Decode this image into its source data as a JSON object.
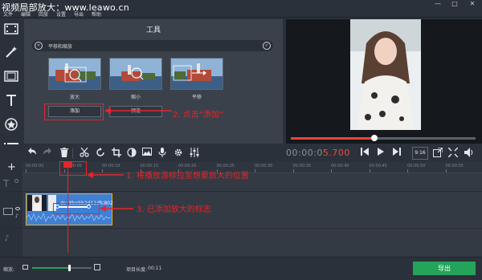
{
  "watermark": "视频局部放大：www.leawo.cn",
  "menu": [
    {
      "label": "文件"
    },
    {
      "label": "编辑"
    },
    {
      "label": "回放"
    },
    {
      "label": "设置"
    },
    {
      "label": "导出"
    },
    {
      "label": "帮助"
    }
  ],
  "window_controls": [
    "—",
    "□",
    "✕"
  ],
  "tools_panel": {
    "title": "工具",
    "section_label": "平移和缩放",
    "back_symbol": "«",
    "check_symbol": "✓",
    "options": [
      {
        "label": "放大"
      },
      {
        "label": "缩小"
      },
      {
        "label": "平移"
      }
    ],
    "add_button": "添加",
    "preview_button": "预览"
  },
  "annotations": {
    "step1": "1. 将播放游标拉至想要放大的位置",
    "step2": "2. 点击“添加”",
    "step3": "3. 已添加放大的标志"
  },
  "playback": {
    "time_white": "00:00:0",
    "time_red": "5.700",
    "aspect": "9:16",
    "progress": 0.45
  },
  "timeline": {
    "ticks": [
      "00:00:00",
      "00:00:05",
      "00:00:10",
      "00:00:15",
      "00:00:20",
      "00:00:25",
      "00:00:30",
      "00:00:35",
      "00:00:40",
      "00:00:45",
      "00:00:50",
      "00:00:55"
    ],
    "clip_name": "dc48bebb2d11dfc802",
    "playhead_time": "00:00:05"
  },
  "footer": {
    "zoom_label": "缩放:",
    "zoom_level": 0.62,
    "duration_label": "项目长度:",
    "duration_value": "00:11",
    "export_button": "导出"
  },
  "colors": {
    "accent_red": "#e4252b",
    "export_green": "#24a35a",
    "clip_blue": "#3f7fd4",
    "clip_border": "#f0b21a"
  }
}
